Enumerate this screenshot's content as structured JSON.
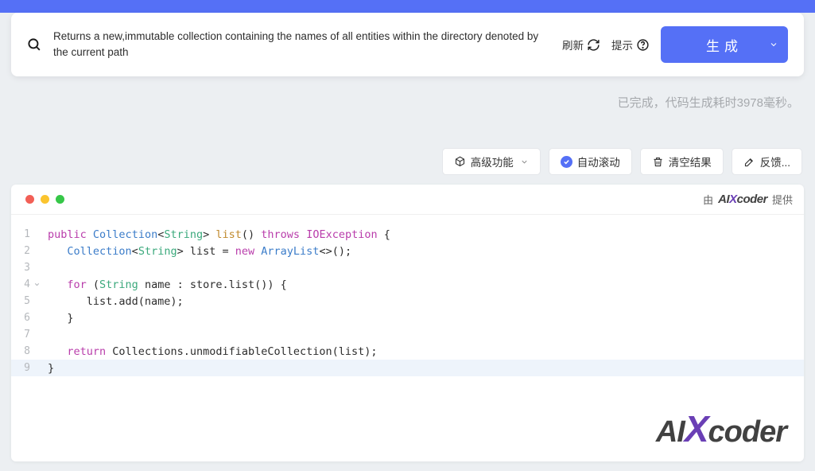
{
  "search": {
    "text": "Returns a new,immutable collection containing the names of all entities within the directory denoted by the current path"
  },
  "actions": {
    "refresh": "刷新",
    "hint": "提示",
    "generate": "生成"
  },
  "status": "已完成，代码生成耗时3978毫秒。",
  "toolbar": {
    "advanced": "高级功能",
    "autoscroll": "自动滚动",
    "clear": "清空结果",
    "feedback": "反馈..."
  },
  "powered": {
    "prefix": "由",
    "suffix": "提供",
    "brand_ai": "AI",
    "brand_x": "X",
    "brand_coder": "coder"
  },
  "code": {
    "lines": [
      {
        "n": "1",
        "html": "<span class='k-public'>public</span> <span class='k-type'>Collection</span>&lt;<span class='k-gen'>String</span>&gt; <span class='k-fn'>list</span>() <span class='k-throws'>throws</span> <span class='k-ex'>IOException</span> {"
      },
      {
        "n": "2",
        "html": "   <span class='k-type'>Collection</span>&lt;<span class='k-gen'>String</span>&gt; list = <span class='k-new'>new</span> <span class='k-type'>ArrayList</span>&lt;&gt;();"
      },
      {
        "n": "3",
        "html": ""
      },
      {
        "n": "4",
        "fold": true,
        "html": "   <span class='k-for'>for</span> (<span class='k-gen'>String</span> name : store.list()) {"
      },
      {
        "n": "5",
        "html": "      list.add(name);"
      },
      {
        "n": "6",
        "html": "   }"
      },
      {
        "n": "7",
        "html": ""
      },
      {
        "n": "8",
        "html": "   <span class='k-return'>return</span> Collections.unmodifiableCollection(list);"
      },
      {
        "n": "9",
        "current": true,
        "html": "}"
      }
    ]
  }
}
